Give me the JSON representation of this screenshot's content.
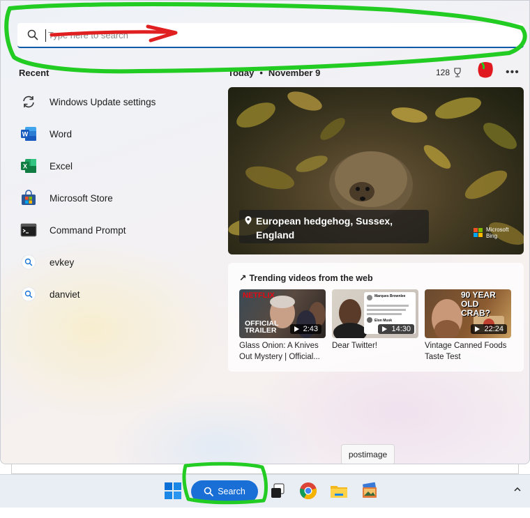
{
  "search": {
    "placeholder": "Type here to search"
  },
  "recent": {
    "title": "Recent",
    "items": [
      {
        "label": "Windows Update settings",
        "icon": "sync-icon"
      },
      {
        "label": "Word",
        "icon": "word-icon"
      },
      {
        "label": "Excel",
        "icon": "excel-icon"
      },
      {
        "label": "Microsoft Store",
        "icon": "store-icon"
      },
      {
        "label": "Command Prompt",
        "icon": "terminal-icon"
      },
      {
        "label": "evkey",
        "icon": "search-icon"
      },
      {
        "label": "danviet",
        "icon": "search-icon"
      }
    ]
  },
  "today": {
    "label": "Today",
    "separator": "•",
    "date": "November 9"
  },
  "rewards": {
    "points": "128"
  },
  "hero": {
    "caption": "European hedgehog, Sussex, England",
    "brand_line1": "Microsoft",
    "brand_line2": "Bing"
  },
  "trending": {
    "title": "Trending videos from the web",
    "videos": [
      {
        "title": "Glass Onion: A Knives Out Mystery | Official...",
        "duration": "2:43",
        "overlay_top": "NETFLIX",
        "overlay_bottom1": "OFFICIAL",
        "overlay_bottom2": "TRAILER"
      },
      {
        "title": "Dear Twitter!",
        "duration": "14:30",
        "overlay_top": "Marques Brownlee",
        "overlay_bottom1": "Elon Musk"
      },
      {
        "title": "Vintage Canned Foods Taste Test",
        "duration": "22:24",
        "overlay_top": "90 YEAR OLD CRAB?"
      }
    ]
  },
  "tooltip": {
    "text": "postimage"
  },
  "taskbar": {
    "search_label": "Search"
  },
  "colors": {
    "accent": "#1a6fd6",
    "annotation_green": "#22cc22",
    "annotation_red": "#e02020"
  }
}
